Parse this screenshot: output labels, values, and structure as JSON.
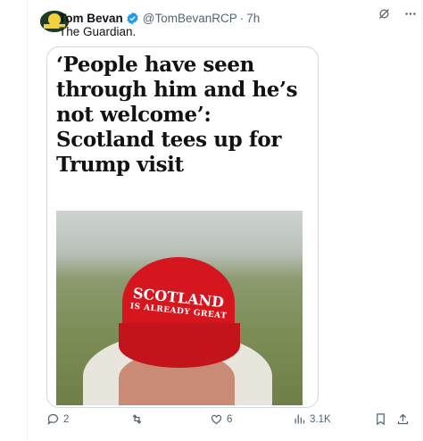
{
  "tweet": {
    "author_name": "Tom Bevan",
    "author_handle": "@TomBevanRCP",
    "separator": "·",
    "time": "7h",
    "text": "The Guardian.",
    "verified_color": "#1d9bf0"
  },
  "card": {
    "headline": "‘People have seen through him and he’s not welcome’: Scotland tees up for Trump visit",
    "image": {
      "cap_line1": "SCOTLAND",
      "cap_line2": "IS ALREADY GREAT"
    }
  },
  "actions": {
    "replies": "2",
    "likes": "6",
    "views": "3.1K"
  },
  "icons": [
    "avatar",
    "verified-icon",
    "grok-icon",
    "more-icon",
    "reply-icon",
    "retweet-icon",
    "like-icon",
    "views-icon",
    "bookmark-icon",
    "share-icon"
  ]
}
